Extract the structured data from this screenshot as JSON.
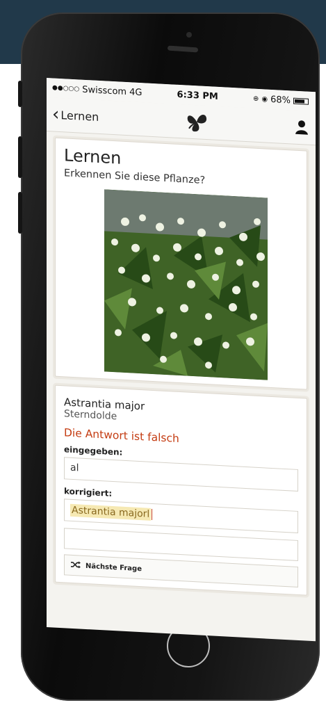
{
  "status_bar": {
    "signal_dots": "●●○○○",
    "carrier": "Swisscom",
    "network": "4G",
    "time": "6:33 PM",
    "battery_percent": "68%",
    "battery_level": 0.68
  },
  "nav": {
    "back_label": "Lernen",
    "back_icon": "chevron-left-icon",
    "logo_icon": "leaf-logo-icon",
    "profile_icon": "user-icon"
  },
  "quiz": {
    "title": "Lernen",
    "question": "Erkennen Sie diese Pflanze?"
  },
  "answer": {
    "latin_name": "Astrantia major",
    "common_name": "Sterndolde",
    "result": "Die Antwort ist falsch",
    "entered_label": "eingegeben:",
    "entered_value": "al",
    "corrected_label": "korrigiert:",
    "corrected_value": "Astrantia majorl",
    "next_label": "Nächste Frage",
    "next_icon": "shuffle-icon"
  },
  "colors": {
    "error": "#c43c12",
    "highlight": "#f6e9b3",
    "background_band": "#21394a"
  }
}
